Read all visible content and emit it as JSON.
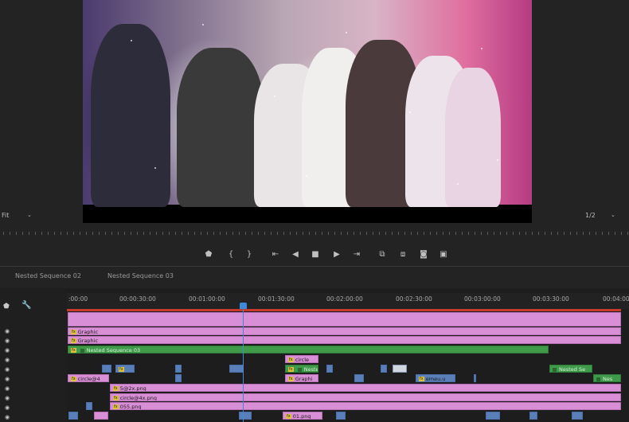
{
  "monitor": {
    "fit_label": "Fit",
    "resolution_label": "1/2"
  },
  "transport": {
    "buttons": [
      "add-marker",
      "mark-in",
      "mark-out",
      "go-to-in",
      "step-back",
      "stop",
      "step-forward",
      "go-to-out",
      "insert",
      "overwrite",
      "export-frame",
      "comparison-view"
    ]
  },
  "timeline": {
    "tabs": [
      "Nested Sequence 02",
      "Nested Sequence 03"
    ],
    "ruler": [
      ":00:00",
      "00:00:30:00",
      "00:01:00:00",
      "00:01:30:00",
      "00:02:00:00",
      "00:02:30:00",
      "00:03:00:00",
      "00:03:30:00",
      "00:04:00"
    ],
    "clips": {
      "graphic1": "Graphic",
      "graphic2": "Graphic",
      "nested03": "Nested Sequence 03",
      "circle": "circle",
      "neste": "Neste",
      "graphi": "Graphi",
      "nested_se": "Nested Se",
      "nes": "Nes",
      "circle4": "circle@4",
      "emeuu": "emeu.u",
      "png1": "5@2x.png",
      "png2": "circle@4x.png",
      "png3": "055.png",
      "png4": "01.png"
    }
  },
  "colors": {
    "playhead": "#3d8bd8",
    "work_area": "#c83a2c",
    "clip_pink": "#d98fd6",
    "clip_green": "#3f9a4a",
    "clip_blue": "#5a7fb8"
  }
}
